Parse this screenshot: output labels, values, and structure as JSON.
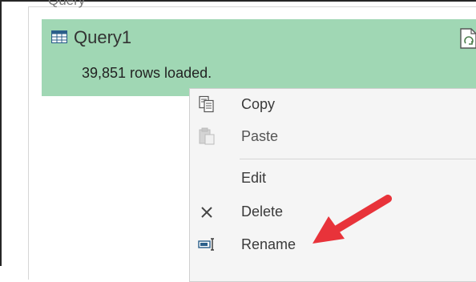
{
  "panel": {
    "title": "Query"
  },
  "query_card": {
    "name": "Query1",
    "status": "39,851 rows loaded.",
    "icons": {
      "table": "table-icon",
      "refresh": "refresh-icon"
    }
  },
  "context_menu": {
    "items": [
      {
        "label": "Copy",
        "icon": "copy-icon",
        "enabled": true
      },
      {
        "label": "Paste",
        "icon": "paste-icon",
        "enabled": false
      },
      {
        "label": "Edit",
        "icon": "",
        "enabled": true
      },
      {
        "label": "Delete",
        "icon": "delete-icon",
        "enabled": true
      },
      {
        "label": "Rename",
        "icon": "rename-icon",
        "enabled": true
      }
    ]
  },
  "colors": {
    "card_bg": "#a0d7b4",
    "menu_bg": "#f5f5f5",
    "annotation_arrow": "#e8333a"
  }
}
